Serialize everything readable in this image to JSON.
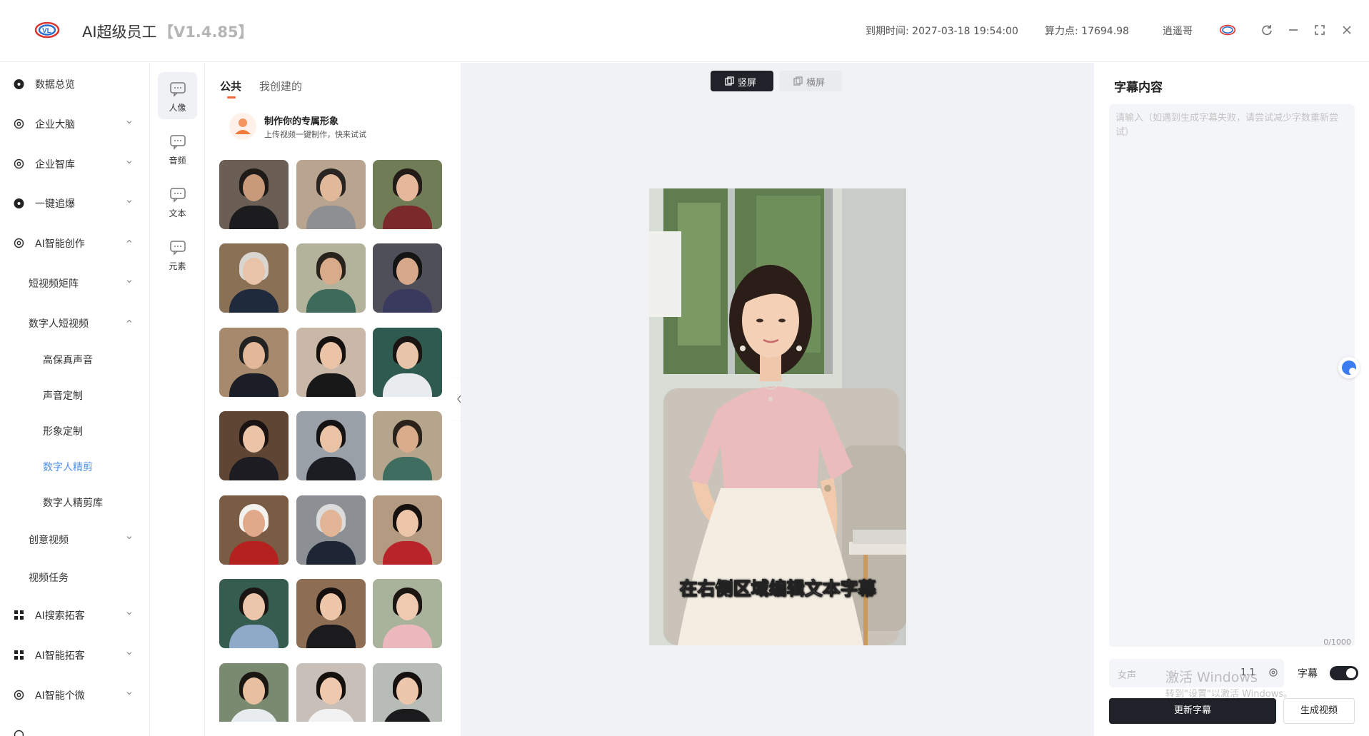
{
  "header": {
    "app_title": "AI超级员工",
    "version": "【V1.4.85】",
    "expire_label": "到期时间: 2027-03-18 19:54:00",
    "compute_label": "算力点: 17694.98",
    "username": "逍遥哥"
  },
  "sidebar": {
    "items": [
      {
        "label": "数据总览"
      },
      {
        "label": "企业大脑"
      },
      {
        "label": "企业智库"
      },
      {
        "label": "一键追爆"
      },
      {
        "label": "AI智能创作"
      },
      {
        "label": "短视频矩阵"
      },
      {
        "label": "数字人短视频"
      },
      {
        "label": "高保真声音"
      },
      {
        "label": "声音定制"
      },
      {
        "label": "形象定制"
      },
      {
        "label": "数字人精剪"
      },
      {
        "label": "数字人精剪库"
      },
      {
        "label": "创意视频"
      },
      {
        "label": "视频任务"
      },
      {
        "label": "AI搜索拓客"
      },
      {
        "label": "AI智能拓客"
      },
      {
        "label": "AI智能个微"
      }
    ]
  },
  "categories": [
    {
      "label": "人像"
    },
    {
      "label": "音频"
    },
    {
      "label": "文本"
    },
    {
      "label": "元素"
    }
  ],
  "avatar_panel": {
    "tabs": [
      {
        "label": "公共"
      },
      {
        "label": "我创建的"
      }
    ],
    "custom_title": "制作你的专属形象",
    "custom_sub": "上传视频一键制作，快来试试"
  },
  "canvas": {
    "portrait_label": "竖屏",
    "landscape_label": "横屏",
    "subtitle_preview": "在右侧区域编辑文本字幕"
  },
  "right_panel": {
    "title": "字幕内容",
    "textarea_placeholder": "请输入（如遇到生成字幕失败，请尝试减少字数重新尝试）",
    "counter": "0/1000",
    "voice_placeholder": "女声",
    "voice_speed": "1.1",
    "subtitle_toggle_label": "字幕",
    "update_button": "更新字幕",
    "generate_button": "生成视频",
    "watermark_line1": "激活 Windows",
    "watermark_line2": "转到\"设置\"以激活 Windows。"
  },
  "colors": {
    "accent": "#4a8fe8",
    "dark_button": "#1f2229",
    "tab_underline": "#f06a3a"
  }
}
